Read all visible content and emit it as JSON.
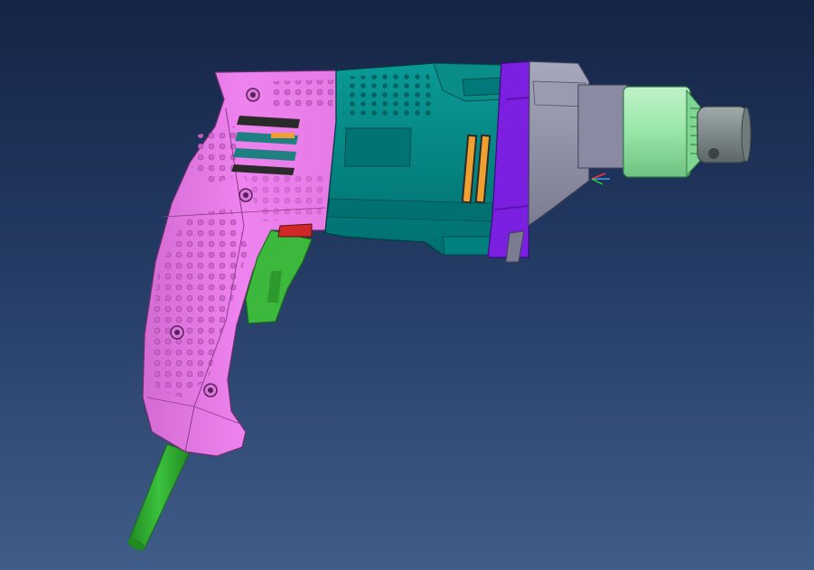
{
  "viewport": {
    "background_top": "#162446",
    "background_bottom": "#3f5d88"
  },
  "model": {
    "colors": {
      "handle": "#ee82ee",
      "handle_shadow": "#c65fc6",
      "body": "#008b8b",
      "body_dark": "#006b6b",
      "collar": "#7b1fe0",
      "gearbox": "#8e8ea6",
      "chuck": "#98e6a8",
      "chuck_tip": "#7a8585",
      "trigger": "#3cb83c",
      "cable": "#2fa02f",
      "vent_orange": "#f0a030",
      "switch_red": "#d02828"
    }
  },
  "triad": {
    "x_color": "#ff3030",
    "y_color": "#30ff30",
    "z_color": "#30a0ff"
  }
}
